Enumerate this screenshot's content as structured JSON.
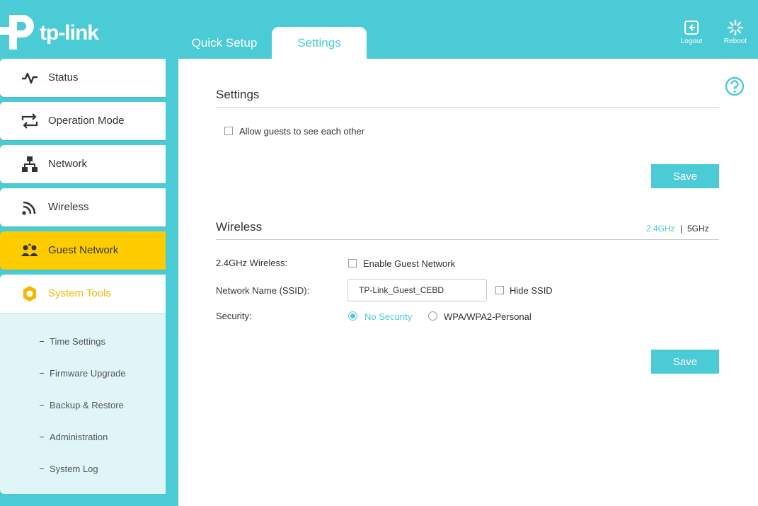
{
  "brand": {
    "name": "tp-link"
  },
  "tabs": {
    "quick_setup": "Quick Setup",
    "settings": "Settings"
  },
  "top_actions": {
    "logout": "Logout",
    "reboot": "Reboot"
  },
  "sidebar": {
    "items": [
      {
        "label": "Status",
        "icon": "status-pulse-icon"
      },
      {
        "label": "Operation Mode",
        "icon": "operation-mode-icon"
      },
      {
        "label": "Network",
        "icon": "network-icon"
      },
      {
        "label": "Wireless",
        "icon": "wireless-icon"
      },
      {
        "label": "Guest Network",
        "icon": "guest-network-icon",
        "active": true
      },
      {
        "label": "System Tools",
        "icon": "gear-icon"
      }
    ],
    "system_tools_sub": [
      "Time Settings",
      "Firmware Upgrade",
      "Backup & Restore",
      "Administration",
      "System Log"
    ]
  },
  "settings_section": {
    "title": "Settings",
    "allow_guests_label": "Allow guests to see each other",
    "allow_guests_checked": false,
    "save_label": "Save"
  },
  "wireless_section": {
    "title": "Wireless",
    "band_24": "2.4GHz",
    "band_sep": "|",
    "band_5": "5GHz",
    "wireless_label": "2.4GHz Wireless:",
    "enable_guest_label": "Enable Guest Network",
    "enable_guest_checked": false,
    "ssid_label": "Network Name (SSID):",
    "ssid_value": "TP-Link_Guest_CEBD",
    "hide_ssid_label": "Hide SSID",
    "security_label": "Security:",
    "security_options": [
      "No Security",
      "WPA/WPA2-Personal"
    ],
    "security_selected": "No Security",
    "save_label": "Save"
  },
  "colors": {
    "accent": "#4acbd6",
    "active": "#ffcc00",
    "tools_text": "#f5b800",
    "submenu_bg": "#dff5f7"
  }
}
